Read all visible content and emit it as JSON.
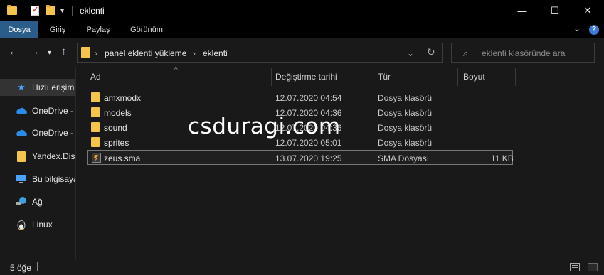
{
  "window": {
    "title": "eklenti",
    "buttons": {
      "minimize": "—",
      "maximize": "☐",
      "close": "✕"
    }
  },
  "ribbon": {
    "tabs": [
      {
        "label": "Dosya",
        "active": true
      },
      {
        "label": "Giriş",
        "active": false
      },
      {
        "label": "Paylaş",
        "active": false
      },
      {
        "label": "Görünüm",
        "active": false
      }
    ]
  },
  "address": {
    "crumbs": [
      "panel eklenti yükleme",
      "eklenti"
    ],
    "search_placeholder": "eklenti klasöründe ara"
  },
  "sidebar": {
    "items": [
      {
        "label": "Hızlı erişim",
        "icon": "star-icon",
        "selected": true
      },
      {
        "label": "OneDrive -",
        "icon": "cloud-icon",
        "selected": false
      },
      {
        "label": "OneDrive -",
        "icon": "cloud-icon",
        "selected": false
      },
      {
        "label": "Yandex.Disk",
        "icon": "folder-icon",
        "selected": false
      },
      {
        "label": "Bu bilgisayar",
        "icon": "computer-icon",
        "selected": false
      },
      {
        "label": "Ağ",
        "icon": "network-icon",
        "selected": false
      },
      {
        "label": "Linux",
        "icon": "linux-icon",
        "selected": false
      }
    ]
  },
  "columns": {
    "name": "Ad",
    "date": "Değiştirme tarihi",
    "type": "Tür",
    "size": "Boyut"
  },
  "files": [
    {
      "name": "amxmodx",
      "date": "12.07.2020 04:54",
      "type": "Dosya klasörü",
      "size": "",
      "icon": "folder-icon"
    },
    {
      "name": "models",
      "date": "12.07.2020 04:36",
      "type": "Dosya klasörü",
      "size": "",
      "icon": "folder-icon"
    },
    {
      "name": "sound",
      "date": "12.07.2020 04:36",
      "type": "Dosya klasörü",
      "size": "",
      "icon": "folder-icon"
    },
    {
      "name": "sprites",
      "date": "12.07.2020 05:01",
      "type": "Dosya klasörü",
      "size": "",
      "icon": "folder-icon"
    },
    {
      "name": "zeus.sma",
      "date": "13.07.2020 19:25",
      "type": "SMA Dosyası",
      "size": "11 KB",
      "icon": "sma-file-icon",
      "selected": true
    }
  ],
  "watermark": "csduragi.com",
  "status": {
    "count": "5 öğe"
  },
  "colors": {
    "accent": "#2b5d8a",
    "folder": "#f4c54a",
    "background": "#191919"
  }
}
